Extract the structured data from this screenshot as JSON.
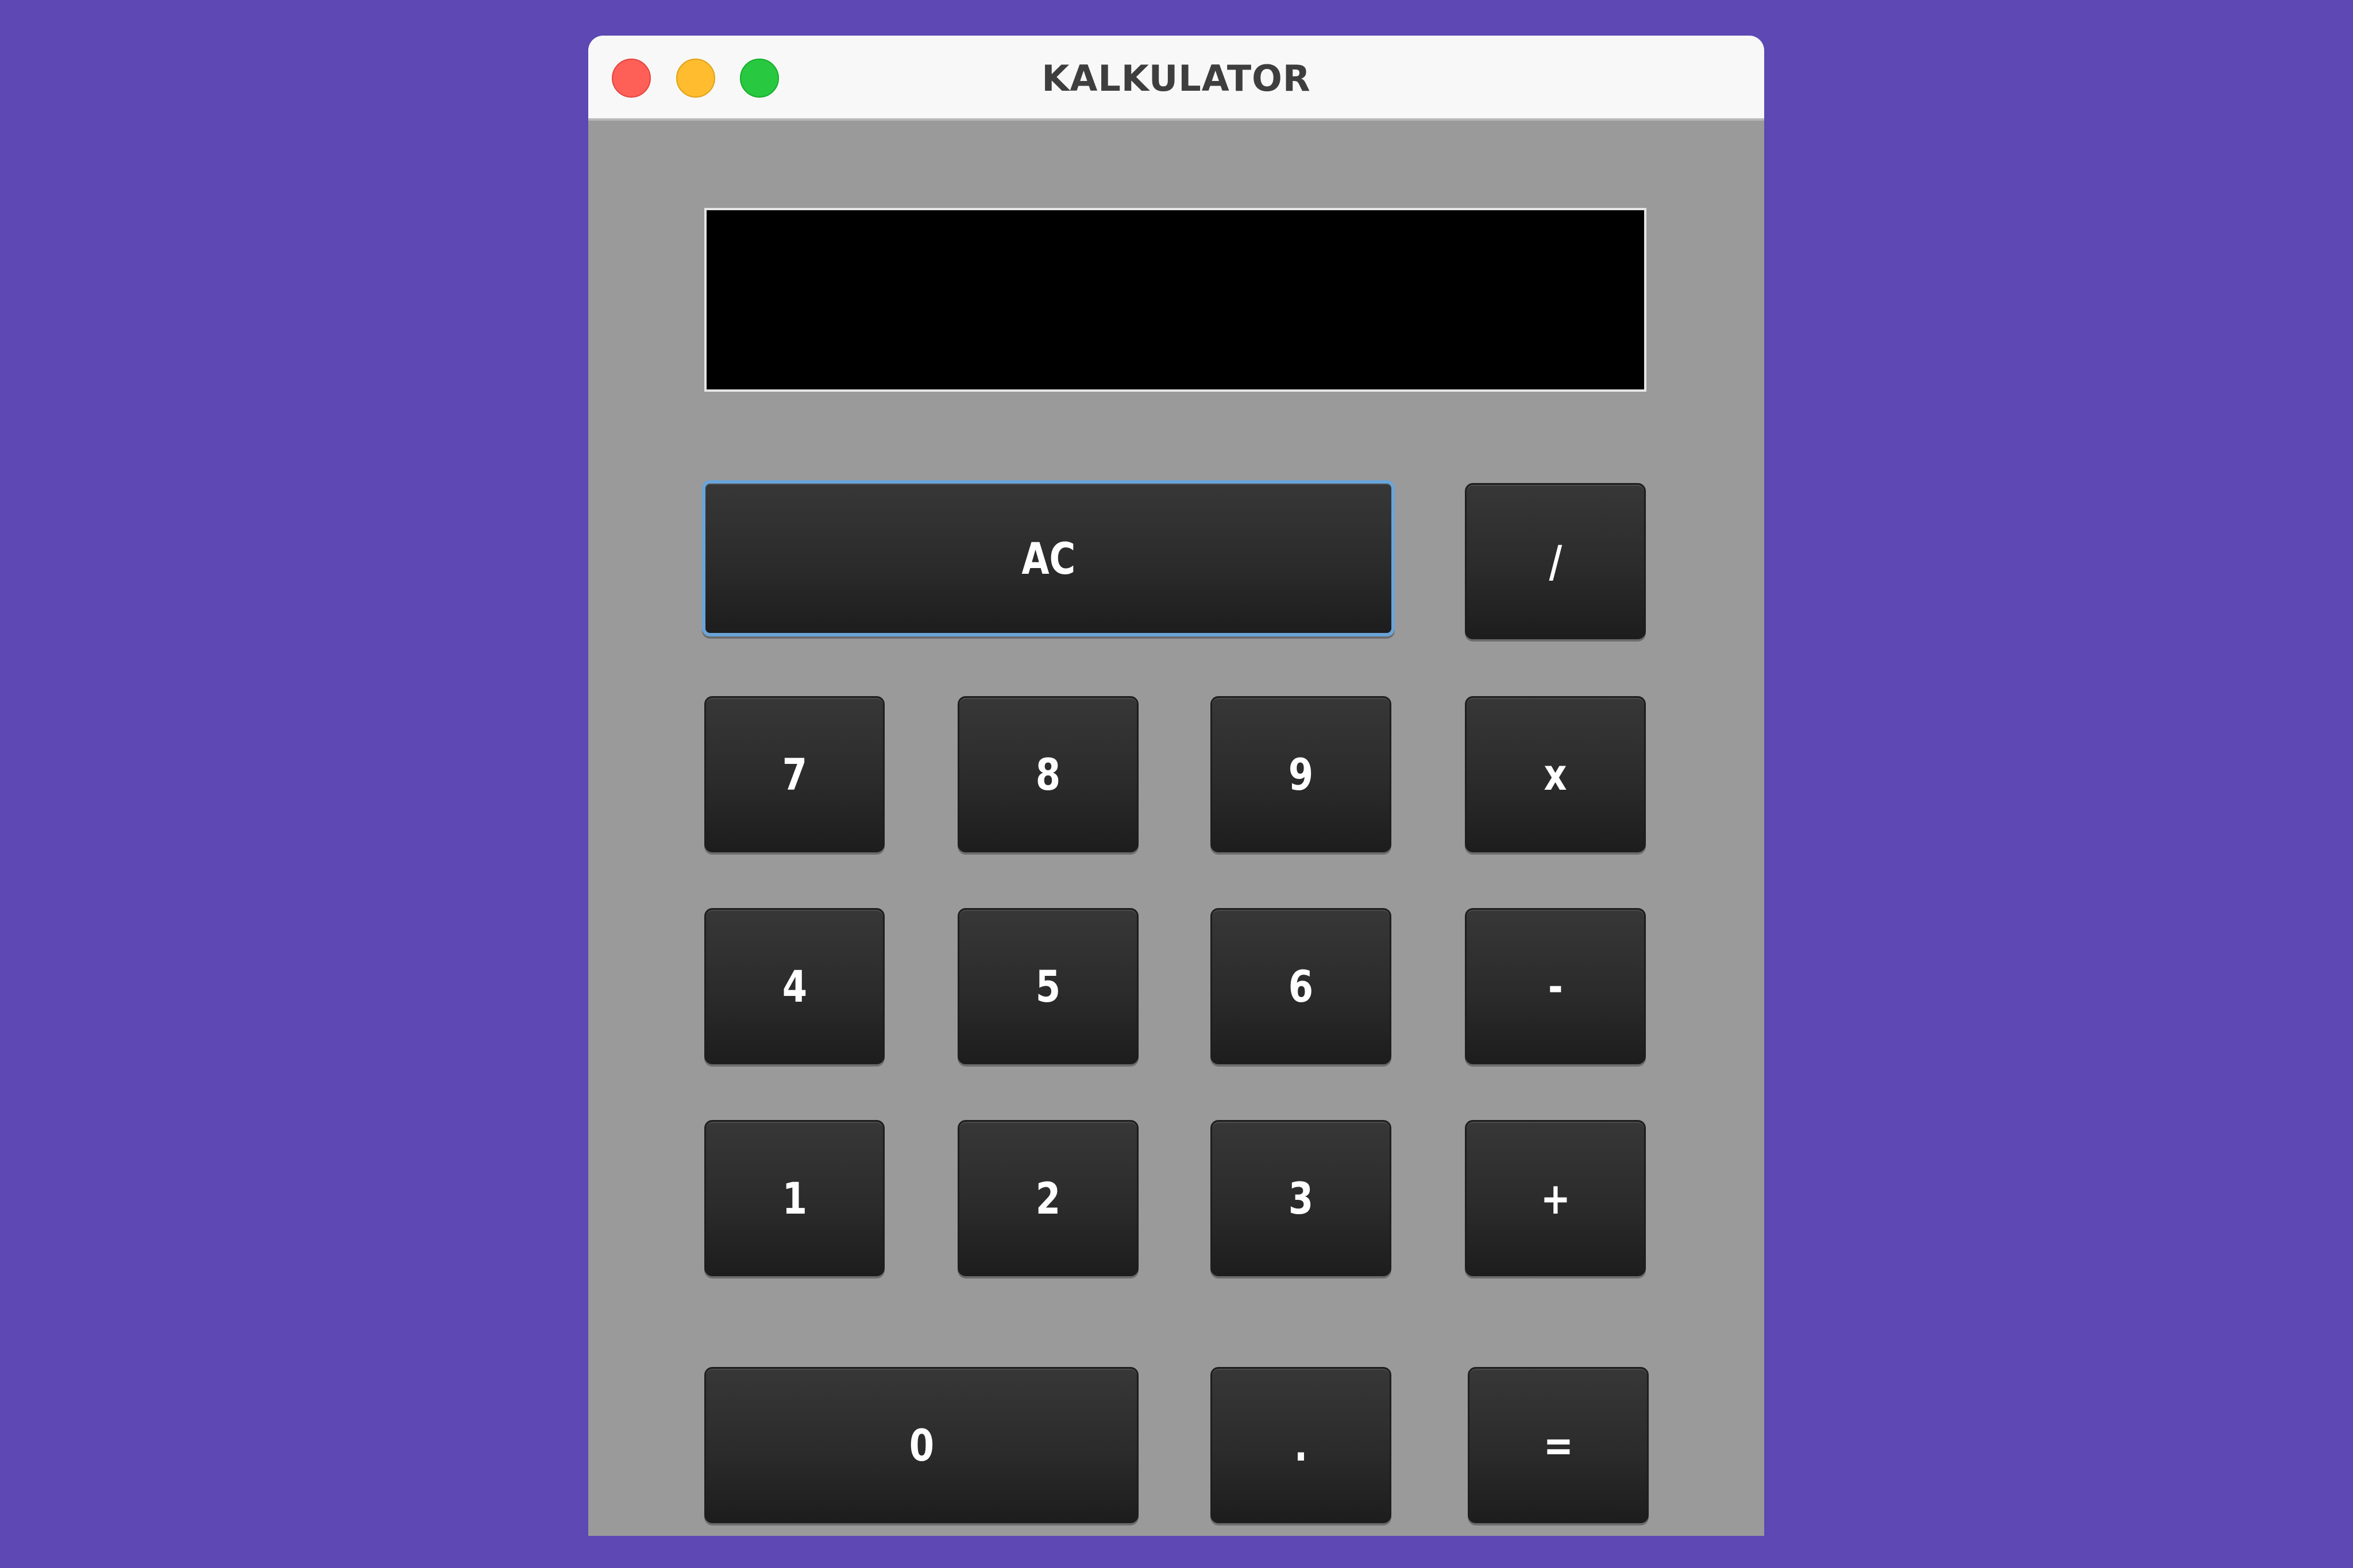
{
  "window": {
    "title": "KALKULATOR"
  },
  "display": {
    "value": ""
  },
  "keys": {
    "ac": "AC",
    "divide": "/",
    "seven": "7",
    "eight": "8",
    "nine": "9",
    "multiply": "x",
    "four": "4",
    "five": "5",
    "six": "6",
    "subtract": "-",
    "one": "1",
    "two": "2",
    "three": "3",
    "add": "+",
    "zero": "0",
    "decimal": ".",
    "equals": "="
  },
  "colors": {
    "desktop": "#5d48b4",
    "window_body": "#9a9a9a",
    "key": "#2b2b2b",
    "focus_ring": "#6aa4d8"
  }
}
